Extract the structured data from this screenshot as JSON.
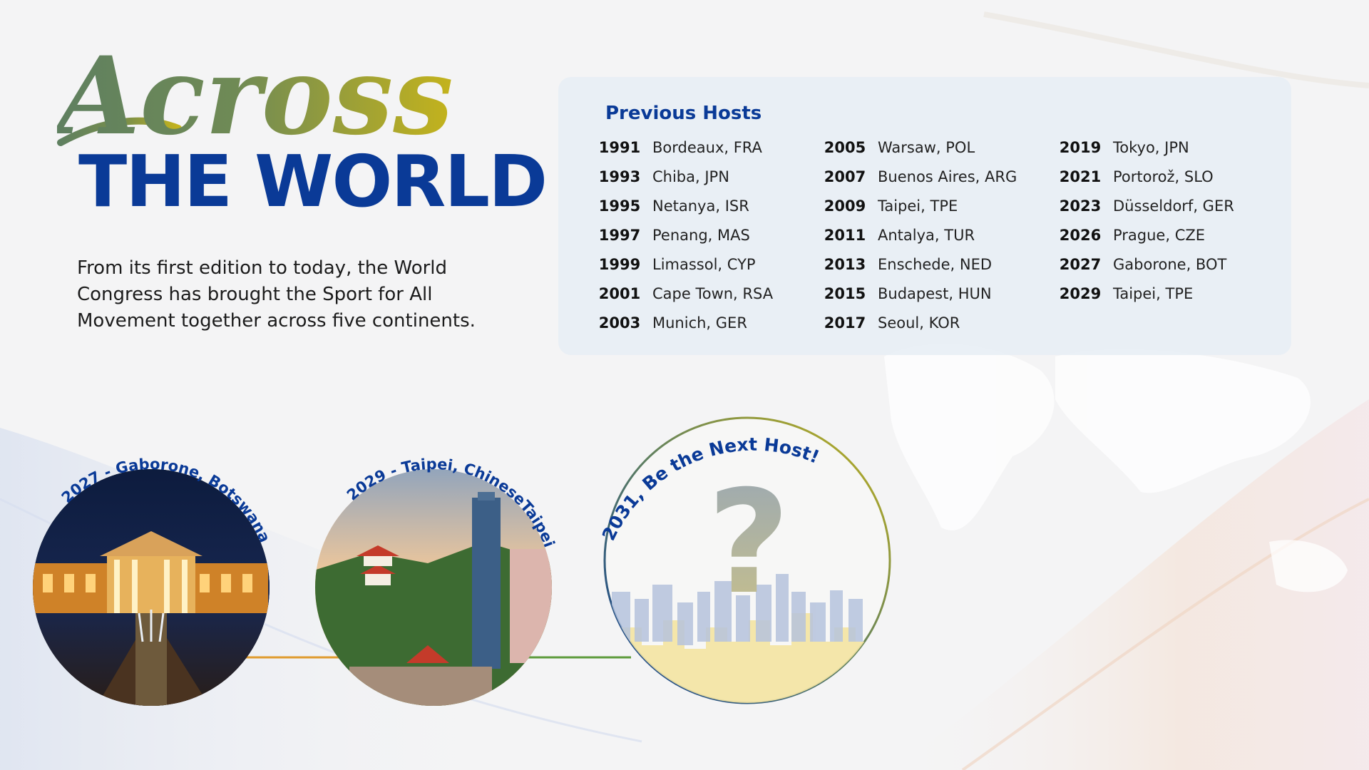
{
  "hero": {
    "script_word": "Across",
    "title": "THE WORLD",
    "intro": "From its first edition to today, the World Congress has brought the Sport for All Movement together across five continents."
  },
  "previous_hosts": {
    "title": "Previous Hosts",
    "columns": [
      [
        {
          "year": "1991",
          "city": "Bordeaux, FRA"
        },
        {
          "year": "1993",
          "city": "Chiba, JPN"
        },
        {
          "year": "1995",
          "city": "Netanya, ISR"
        },
        {
          "year": "1997",
          "city": "Penang, MAS"
        },
        {
          "year": "1999",
          "city": "Limassol, CYP"
        },
        {
          "year": "2001",
          "city": "Cape Town, RSA"
        },
        {
          "year": "2003",
          "city": "Munich, GER"
        }
      ],
      [
        {
          "year": "2005",
          "city": "Warsaw, POL"
        },
        {
          "year": "2007",
          "city": "Buenos Aires, ARG"
        },
        {
          "year": "2009",
          "city": "Taipei, TPE"
        },
        {
          "year": "2011",
          "city": "Antalya, TUR"
        },
        {
          "year": "2013",
          "city": "Enschede, NED"
        },
        {
          "year": "2015",
          "city": "Budapest, HUN"
        },
        {
          "year": "2017",
          "city": "Seoul, KOR"
        }
      ],
      [
        {
          "year": "2019",
          "city": "Tokyo, JPN"
        },
        {
          "year": "2021",
          "city": "Portorož, SLO"
        },
        {
          "year": "2023",
          "city": "Düsseldorf, GER"
        },
        {
          "year": "2026",
          "city": "Prague, CZE"
        },
        {
          "year": "2027",
          "city": "Gaborone, BOT"
        },
        {
          "year": "2029",
          "city": "Taipei, TPE"
        }
      ]
    ]
  },
  "timeline": {
    "gaborone_label": "2027 - Gaborone, Botswana",
    "taipei_label": "2029 - Taipei, ChineseTaipei",
    "next_label": "2031, Be the Next Host!",
    "question_mark": "?"
  },
  "colors": {
    "brand_blue": "#0a3a97",
    "script_green": "#5f8060",
    "script_gold": "#c4b31c",
    "line_orange": "#e09b2d",
    "line_green": "#5c9a3b"
  }
}
